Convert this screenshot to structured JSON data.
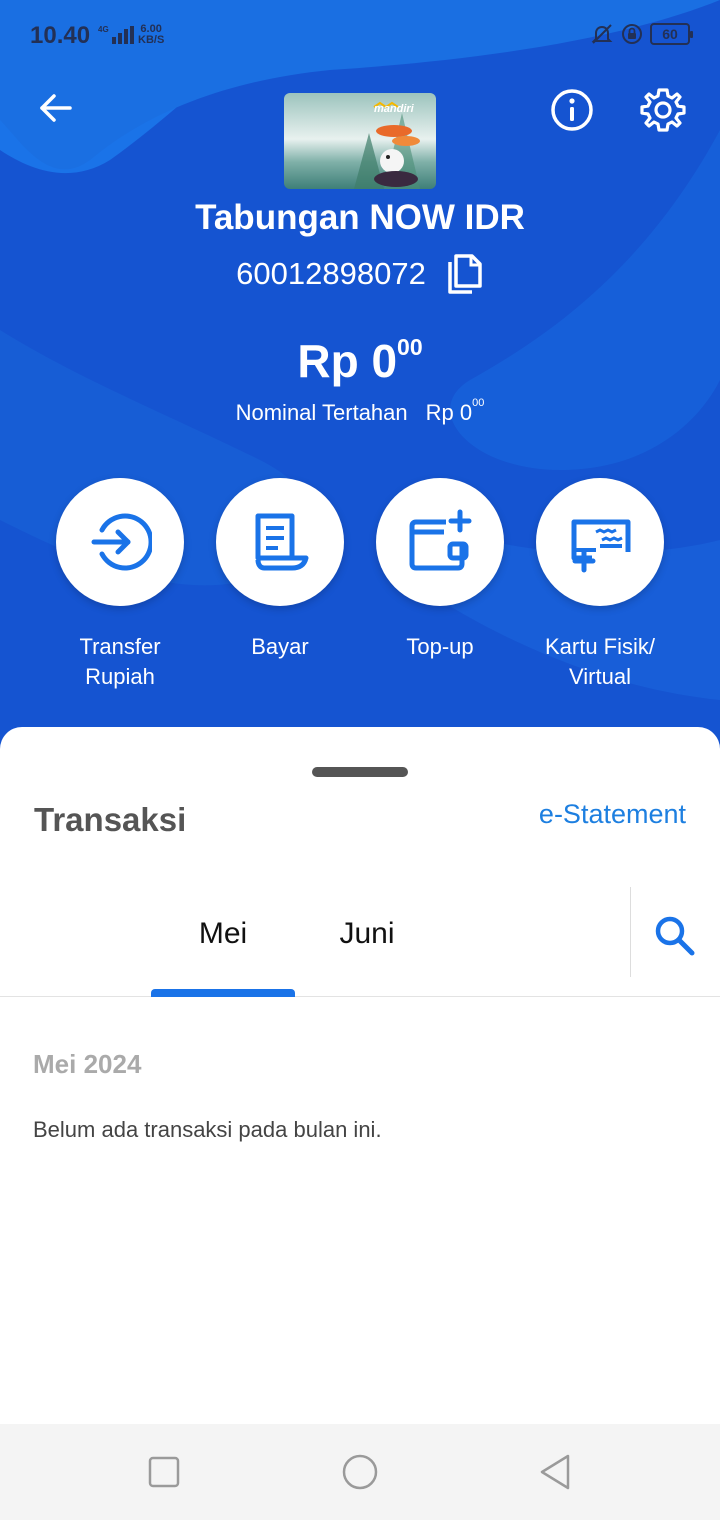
{
  "status_bar": {
    "time": "10.40",
    "network": "4G",
    "speed_value": "6.00",
    "speed_unit": "KB/S",
    "battery": "60"
  },
  "header": {
    "card_brand": "mandiri",
    "account_name": "Tabungan NOW IDR",
    "account_number": "60012898072",
    "balance_main": "Rp 0",
    "balance_cents": "00",
    "held_label": "Nominal Tertahan",
    "held_main": "Rp 0",
    "held_cents": "00"
  },
  "actions": [
    {
      "label": "Transfer\nRupiah",
      "icon": "transfer-icon"
    },
    {
      "label": "Bayar",
      "icon": "bill-icon"
    },
    {
      "label": "Top-up",
      "icon": "wallet-add-icon"
    },
    {
      "label": "Kartu Fisik/\nVirtual",
      "icon": "card-add-icon"
    }
  ],
  "transactions": {
    "title": "Transaksi",
    "estatement_label": "e-Statement",
    "tabs": [
      {
        "label": "Mei",
        "active": true
      },
      {
        "label": "Juni",
        "active": false
      }
    ],
    "month_heading": "Mei 2024",
    "empty_message": "Belum ada transaksi pada bulan ini."
  },
  "colors": {
    "header_blue": "#1554d1",
    "accent_blue": "#1a73e8",
    "link_blue": "#1d7fe0"
  }
}
